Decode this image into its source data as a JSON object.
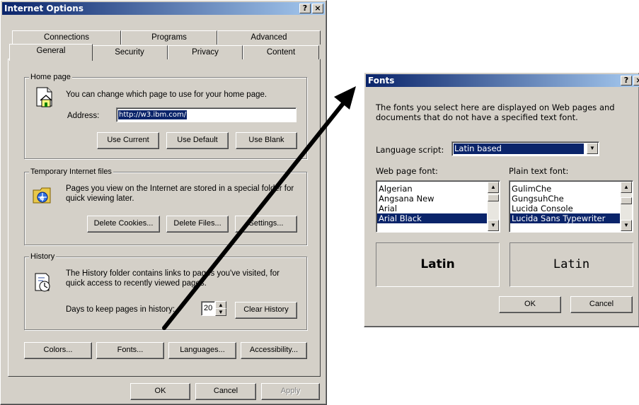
{
  "internet_options": {
    "title": "Internet Options",
    "help_btn": "?",
    "close_btn": "×",
    "tabs_back": [
      "Connections",
      "Programs",
      "Advanced"
    ],
    "tabs_front": [
      "General",
      "Security",
      "Privacy",
      "Content"
    ],
    "home_page": {
      "label": "Home page",
      "description": "You can change which page to use for your home page.",
      "address_label": "Address:",
      "address_value": "http://w3.ibm.com/",
      "use_current": "Use Current",
      "use_default": "Use Default",
      "use_blank": "Use Blank"
    },
    "temp_files": {
      "label": "Temporary Internet files",
      "description": "Pages you view on the Internet are stored in a special folder for quick viewing later.",
      "delete_cookies": "Delete Cookies...",
      "delete_files": "Delete Files...",
      "settings": "Settings..."
    },
    "history": {
      "label": "History",
      "description": "The History folder contains links to pages you've visited, for quick access to recently viewed pages.",
      "days_label": "Days to keep pages in history:",
      "days_value": "20",
      "clear_history": "Clear History"
    },
    "bottom_buttons": {
      "colors": "Colors...",
      "fonts": "Fonts...",
      "languages": "Languages...",
      "accessibility": "Accessibility..."
    },
    "ok": "OK",
    "cancel": "Cancel",
    "apply": "Apply"
  },
  "fonts_dialog": {
    "title": "Fonts",
    "help_btn": "?",
    "close_btn": "×",
    "description": "The fonts you select here are displayed on Web pages and documents that do not have a specified text font.",
    "language_script_label": "Language script:",
    "language_script_value": "Latin based",
    "web_font_label": "Web page font:",
    "plain_font_label": "Plain text font:",
    "web_fonts": [
      "Algerian",
      "Angsana New",
      "Arial",
      "Arial Black"
    ],
    "web_font_selected": "Arial Black",
    "plain_fonts": [
      "GulimChe",
      "GungsuhChe",
      "Lucida Console",
      "Lucida Sans Typewriter"
    ],
    "plain_font_selected": "Lucida Sans Typewriter",
    "web_preview": "Latin",
    "plain_preview": "Latin",
    "ok": "OK",
    "cancel": "Cancel"
  },
  "colors": {
    "titlebar_start": "#0a246a",
    "titlebar_end": "#a6caf0",
    "face": "#d4d0c8",
    "selection": "#0a246a",
    "arrow": "#000000"
  }
}
